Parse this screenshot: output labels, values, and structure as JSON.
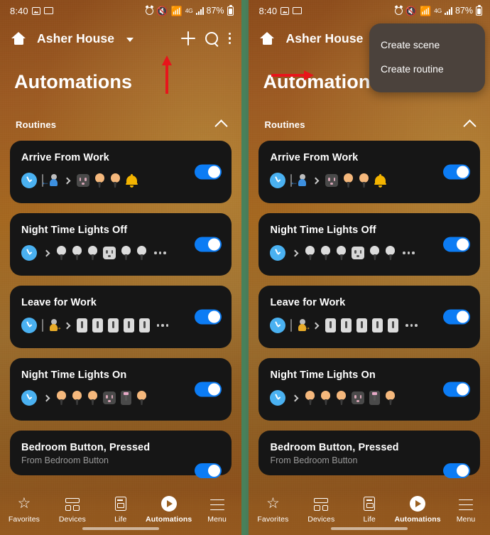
{
  "status_bar": {
    "time": "8:40",
    "battery_percent": "87%",
    "network_label": "4G",
    "icons": [
      "gallery-icon",
      "cast-icon",
      "alarm-icon",
      "mute-icon",
      "wifi-icon",
      "lte-icon",
      "signal-bars-icon",
      "battery-icon"
    ]
  },
  "app_bar": {
    "home_icon": "home-icon",
    "house_name": "Asher House",
    "caret_icon": "chevron-down-icon",
    "add_icon": "plus-icon",
    "search_icon": "search-icon",
    "overflow_icon": "more-vertical-icon"
  },
  "page": {
    "title": "Automations"
  },
  "section": {
    "label": "Routines",
    "collapse_icon": "chevron-up-icon"
  },
  "popup_menu": {
    "visible_on": "right-panel",
    "items": [
      {
        "label": "Create scene"
      },
      {
        "label": "Create routine"
      }
    ],
    "background": "#4b423c"
  },
  "annotations": {
    "left_arrow_target": "plus-icon",
    "right_arrow_target": "Create routine",
    "color": "#e8151b"
  },
  "routines": [
    {
      "title": "Arrive From Work",
      "subtitle": "",
      "toggle_on": true,
      "trigger": {
        "clock": true,
        "presence": "arrive"
      },
      "actions": [
        "outlet-dark",
        "bulb-orange",
        "bulb-orange",
        "bell"
      ],
      "overflow": false
    },
    {
      "title": "Night Time Lights Off",
      "subtitle": "",
      "toggle_on": true,
      "trigger": {
        "clock": true,
        "presence": ""
      },
      "actions": [
        "bulb-white",
        "bulb-white",
        "bulb-white",
        "outlet-light",
        "bulb-white",
        "bulb-white"
      ],
      "overflow": true
    },
    {
      "title": "Leave for Work",
      "subtitle": "",
      "toggle_on": true,
      "trigger": {
        "clock": true,
        "presence": "leave"
      },
      "actions": [
        "switch-light",
        "switch-light",
        "switch-light",
        "switch-light",
        "switch-light"
      ],
      "overflow": true
    },
    {
      "title": "Night Time Lights On",
      "subtitle": "",
      "toggle_on": true,
      "trigger": {
        "clock": true,
        "presence": ""
      },
      "actions": [
        "bulb-orange",
        "bulb-orange",
        "bulb-orange",
        "outlet-dark",
        "switch-dark",
        "bulb-orange"
      ],
      "overflow": false
    },
    {
      "title": "Bedroom Button, Pressed",
      "subtitle": "From Bedroom Button",
      "toggle_on": true,
      "trigger": {
        "clock": false,
        "presence": ""
      },
      "actions": [],
      "overflow": false,
      "clipped": true
    }
  ],
  "bottom_nav": {
    "items": [
      {
        "label": "Favorites",
        "icon": "star-icon",
        "active": false
      },
      {
        "label": "Devices",
        "icon": "devices-grid-icon",
        "active": false
      },
      {
        "label": "Life",
        "icon": "life-document-icon",
        "active": false
      },
      {
        "label": "Automations",
        "icon": "play-circle-icon",
        "active": true
      },
      {
        "label": "Menu",
        "icon": "hamburger-menu-icon",
        "active": false
      }
    ]
  },
  "colors": {
    "toggle_on": "#0c7cf4",
    "card_bg": "#161616",
    "divider_green": "#48815a",
    "accent_bulb_orange": "#f5b87c",
    "bell_yellow": "#f4b400"
  }
}
